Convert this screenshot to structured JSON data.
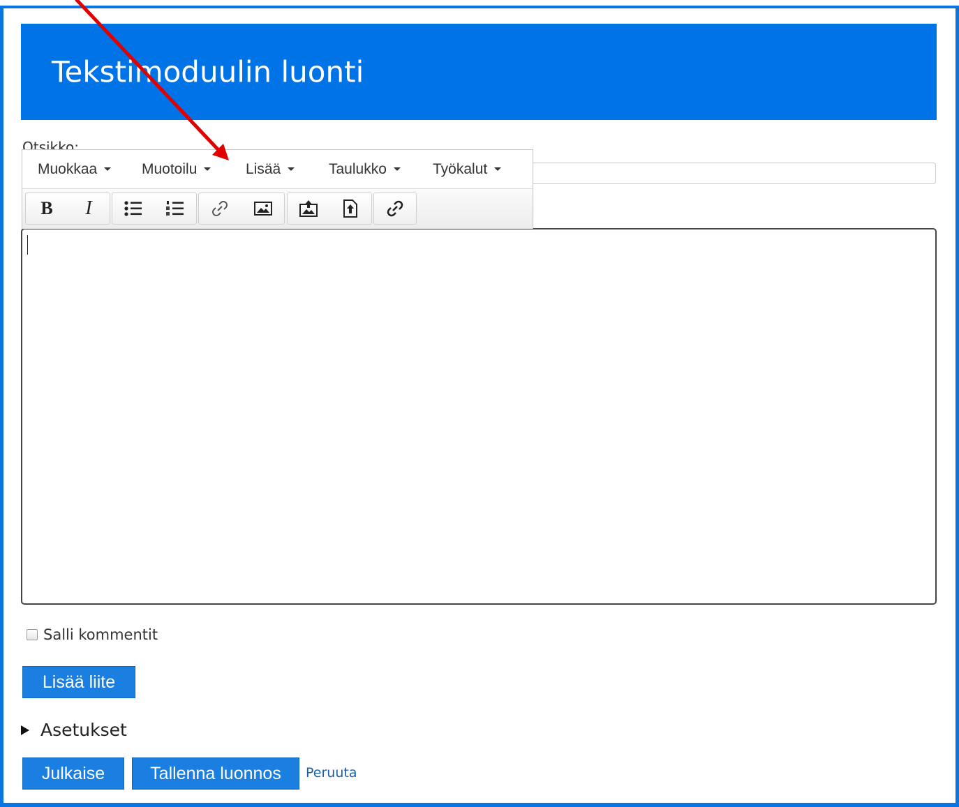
{
  "page": {
    "title": "Tekstimoduulin luonti"
  },
  "form": {
    "title_label": "Otsikko:",
    "title_value": "",
    "body_value": "",
    "allow_comments_label": "Salli kommentit",
    "allow_comments_checked": false,
    "add_attachment_label": "Lisää liite",
    "settings_label": "Asetukset",
    "publish_label": "Julkaise",
    "save_draft_label": "Tallenna luonnos",
    "cancel_label": "Peruuta"
  },
  "editor": {
    "menus": [
      {
        "label": "Muokkaa"
      },
      {
        "label": "Muotoilu"
      },
      {
        "label": "Lisää"
      },
      {
        "label": "Taulukko"
      },
      {
        "label": "Työkalut"
      }
    ],
    "buttons": [
      {
        "icon": "bold-icon"
      },
      {
        "icon": "italic-icon"
      },
      {
        "icon": "bullet-list-icon"
      },
      {
        "icon": "numbered-list-icon"
      },
      {
        "icon": "link-icon"
      },
      {
        "icon": "image-icon"
      },
      {
        "icon": "upload-image-icon"
      },
      {
        "icon": "upload-file-icon"
      },
      {
        "icon": "insert-link-icon"
      }
    ]
  },
  "colors": {
    "header_bg": "#0073e6",
    "button_bg": "#1a7fe0",
    "annotation_arrow": "#e00000"
  }
}
